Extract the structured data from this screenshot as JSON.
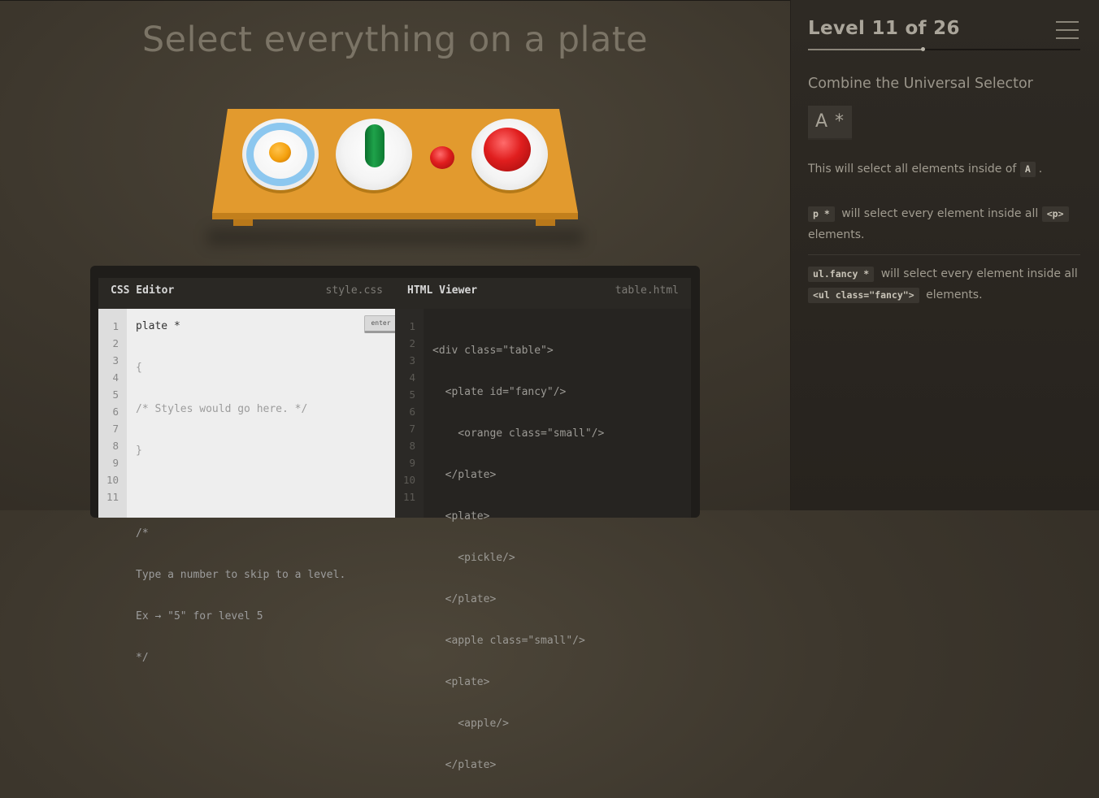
{
  "main": {
    "title": "Select everything on a plate"
  },
  "board": {
    "items": [
      {
        "plate": "plate",
        "fancy": true,
        "item": "orange"
      },
      {
        "plate": "plate",
        "fancy": false,
        "item": "pickle"
      },
      {
        "plate": null,
        "item": "apple"
      },
      {
        "plate": "plate",
        "fancy": false,
        "item": "apple"
      }
    ]
  },
  "css_editor": {
    "title": "CSS Editor",
    "filename": "style.css",
    "input_value": "plate *",
    "enter_label": "enter",
    "line_numbers": [
      "1",
      "2",
      "3",
      "4",
      "5",
      "6",
      "7",
      "8",
      "9",
      "10",
      "11"
    ],
    "lines": [
      "{",
      "/* Styles would go here. */",
      "}",
      "",
      "/*",
      "Type a number to skip to a level.",
      "Ex → \"5\" for level 5",
      "*/",
      ""
    ]
  },
  "html_viewer": {
    "title": "HTML Viewer",
    "filename": "table.html",
    "line_numbers": [
      "1",
      "2",
      "3",
      "4",
      "5",
      "6",
      "7",
      "8",
      "9",
      "10",
      "11"
    ],
    "lines": [
      "<div class=\"table\">",
      "  <plate id=\"fancy\"/>",
      "    <orange class=\"small\"/>",
      "  </plate>",
      "  <plate>",
      "    <pickle/>",
      "  </plate>",
      "  <apple class=\"small\"/>",
      "  <plate>",
      "    <apple/>",
      "  </plate>"
    ]
  },
  "sidebar": {
    "level_title": "Level 11 of 26",
    "progress_fraction": 0.42,
    "selector_name": "Combine the Universal Selector",
    "syntax": "A  *",
    "hint_prefix": "This will select all elements inside of",
    "hint_tag": "A",
    "hint_suffix": ".",
    "example1_tag": "p  *",
    "example1_text": "will select every element inside all",
    "example1_tag2": "<p>",
    "example1_suffix": "elements.",
    "example2_tag": "ul.fancy  *",
    "example2_text": "will select every element inside all",
    "example2_tag2": "<ul class=\"fancy\">",
    "example2_suffix": "elements."
  },
  "colors": {
    "table": "#e29a2e",
    "orange": "#f4a10e",
    "pickle": "#1fa24a",
    "apple": "#e01e1e",
    "fancy_ring": "#8cc7ef"
  }
}
